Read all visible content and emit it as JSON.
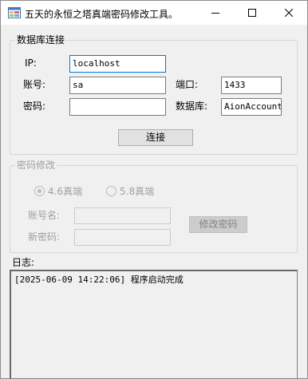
{
  "window": {
    "title": "五天的永恒之塔真端密码修改工具。"
  },
  "db_group": {
    "legend": "数据库连接",
    "ip_label": "IP:",
    "ip_value": "localhost",
    "account_label": "账号:",
    "account_value": "sa",
    "port_label": "端口:",
    "port_value": "1433",
    "password_label": "密码:",
    "password_value": "",
    "database_label": "数据库:",
    "database_value": "AionAccount",
    "connect_label": "连接"
  },
  "pwd_group": {
    "legend": "密码修改",
    "radio_46": "4.6真端",
    "radio_58": "5.8真端",
    "account_name_label": "账号名:",
    "new_password_label": "新密码:",
    "modify_label": "修改密码"
  },
  "log": {
    "label": "日志:",
    "lines": [
      "[2025-06-09 14:22:06] 程序启动完成"
    ]
  }
}
